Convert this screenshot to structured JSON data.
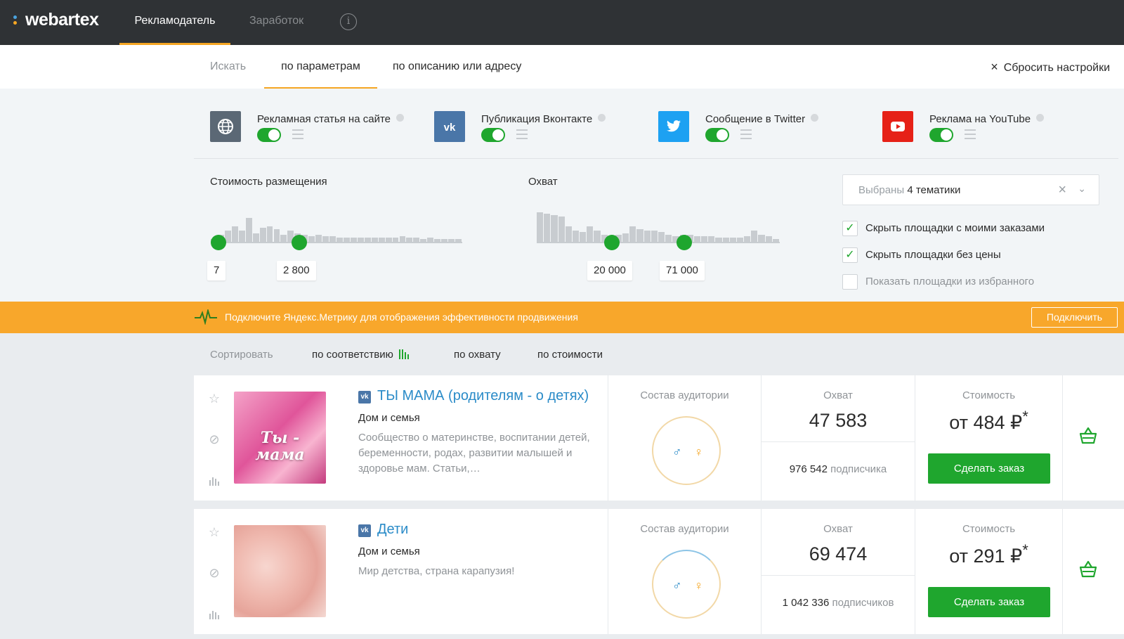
{
  "header": {
    "logo": "webartex",
    "tabs": [
      {
        "label": "Рекламодатель",
        "active": true
      },
      {
        "label": "Заработок",
        "active": false
      }
    ],
    "info_icon": "i"
  },
  "search": {
    "label": "Искать",
    "tabs": [
      {
        "label": "по параметрам",
        "active": true
      },
      {
        "label": "по описанию или адресу",
        "active": false
      }
    ],
    "reset_icon": "×",
    "reset_label": "Сбросить настройки"
  },
  "channels": [
    {
      "label": "Рекламная статья на сайте",
      "icon": "globe-icon",
      "color": "#5b6875",
      "enabled": true
    },
    {
      "label": "Публикация Вконтакте",
      "icon": "vk-icon",
      "color": "#4a76a8",
      "enabled": true
    },
    {
      "label": "Сообщение в Twitter",
      "icon": "twitter-icon",
      "color": "#1da1f2",
      "enabled": true
    },
    {
      "label": "Реклама на YouTube",
      "icon": "youtube-icon",
      "color": "#e62117",
      "enabled": true
    }
  ],
  "cost_filter": {
    "title": "Стоимость размещения",
    "min": "7",
    "max": "2 800"
  },
  "reach_filter": {
    "title": "Охват",
    "min": "20 000",
    "max": "71 000"
  },
  "topics": {
    "prefix": "Выбраны",
    "value": "4 тематики",
    "clear_icon": "×",
    "chevron_icon": "⌄"
  },
  "checkboxes": [
    {
      "label": "Скрыть площадки с моими заказами",
      "checked": true
    },
    {
      "label": "Скрыть площадки без цены",
      "checked": true
    },
    {
      "label": "Показать площадки из избранного",
      "checked": false
    }
  ],
  "banner": {
    "message": "Подключите Яндекс.Метрику для отображения эффективности продвижения",
    "button": "Подключить"
  },
  "sort": {
    "label": "Сортировать",
    "options": [
      "по соответствию",
      "по охвату",
      "по стоимости"
    ],
    "active_index": 0
  },
  "listings": [
    {
      "title": "ТЫ МАМА (родителям - о детях)",
      "category": "Дом и семья",
      "description": "Сообщество о материнстве, воспитании детей, беременности, родах, развитии малышей и здоровье мам. Статьи,…",
      "audience_label": "Состав аудитории",
      "reach_label": "Охват",
      "reach": "47 583",
      "subscribers": "976 542",
      "subscribers_word": "подписчика",
      "price_label": "Стоимость",
      "price": "от 484 ₽",
      "price_mark": "*",
      "order_button": "Сделать заказ",
      "thumb_text": "Ты - мама"
    },
    {
      "title": "Дети",
      "category": "Дом и семья",
      "description": "Мир детства, страна карапузия!",
      "audience_label": "Состав аудитории",
      "reach_label": "Охват",
      "reach": "69 474",
      "subscribers": "1 042 336",
      "subscribers_word": "подписчиков",
      "price_label": "Стоимость",
      "price": "от 291 ₽",
      "price_mark": "*",
      "order_button": "Сделать заказ",
      "thumb_text": ""
    }
  ],
  "colors": {
    "accent": "#f5a623",
    "green": "#1fa62e",
    "link": "#2a8bc8",
    "topbar": "#2f3235"
  }
}
